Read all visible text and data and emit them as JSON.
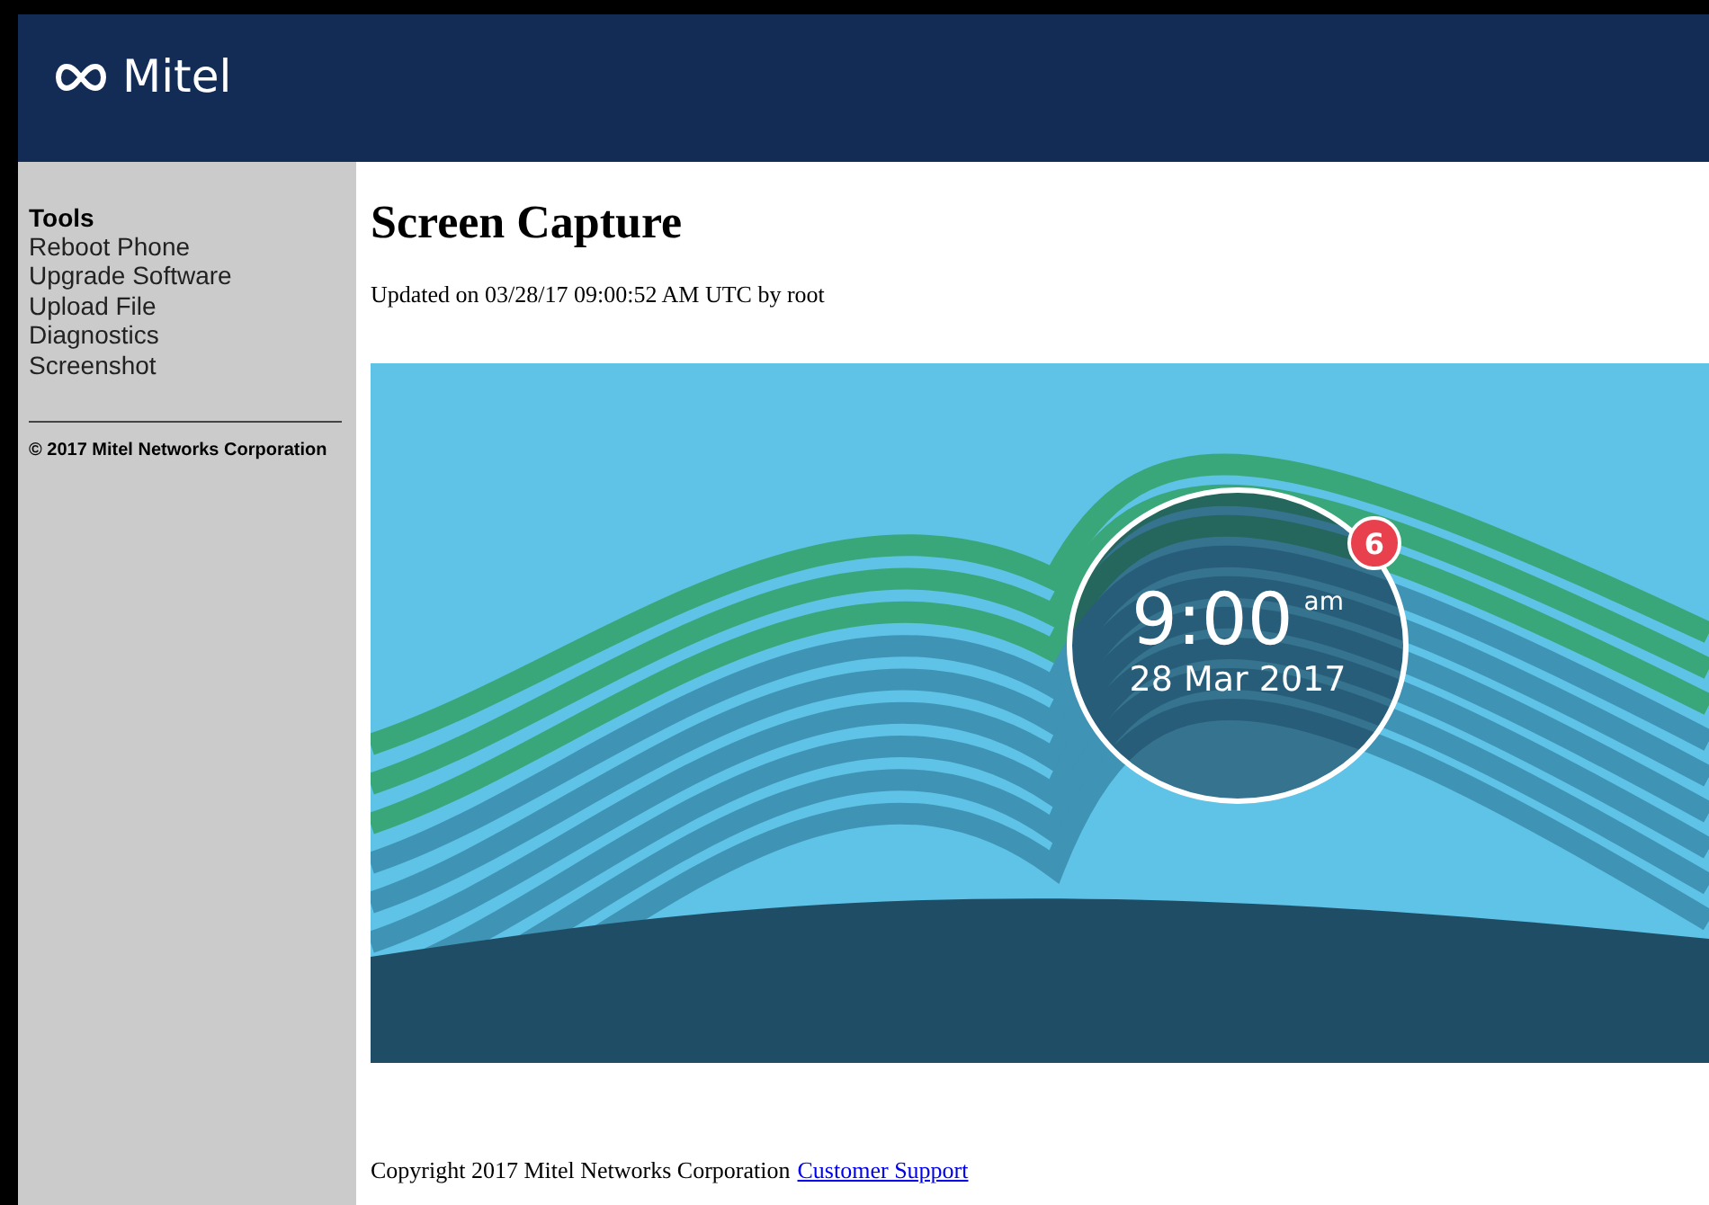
{
  "header": {
    "logo_text": "Mitel"
  },
  "sidebar": {
    "heading": "Tools",
    "items": [
      {
        "label": "Reboot Phone"
      },
      {
        "label": "Upgrade Software"
      },
      {
        "label": "Upload File"
      },
      {
        "label": "Diagnostics"
      },
      {
        "label": "Screenshot"
      }
    ],
    "copyright": "© 2017 Mitel Networks Corporation"
  },
  "main": {
    "title": "Screen Capture",
    "updated": "Updated on 03/28/17 09:00:52 AM UTC by root",
    "phone_screen": {
      "time": "9:00",
      "meridiem": "am",
      "date": "28 Mar 2017",
      "badge": "6"
    },
    "footer": {
      "text": "Copyright 2017 Mitel Networks Corporation",
      "link": "Customer Support"
    }
  }
}
